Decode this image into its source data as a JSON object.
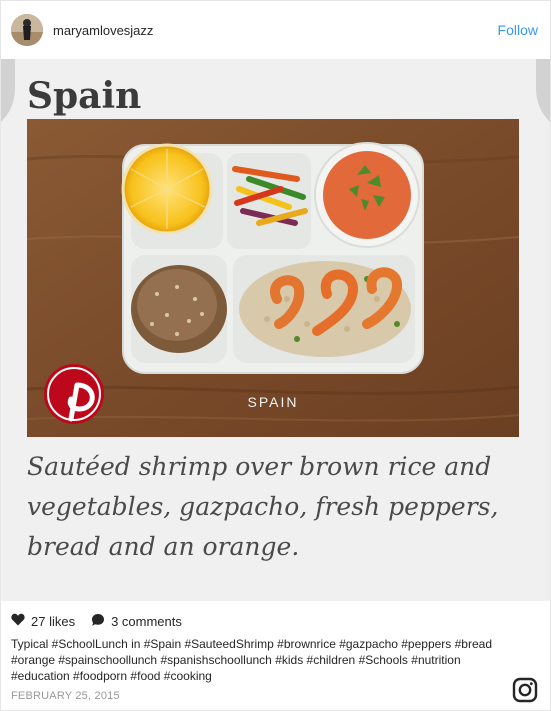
{
  "header": {
    "username": "maryamlovesjazz",
    "follow_label": "Follow"
  },
  "media": {
    "heading": "Spain",
    "photo_label": "SPAIN",
    "caption": "Sautéed shrimp over brown rice and vegetables, gazpacho, fresh peppers, bread and an orange.",
    "pinterest_icon": "pinterest-logo"
  },
  "stats": {
    "likes": "27 likes",
    "comments": "3 comments",
    "like_icon": "heart-icon",
    "comment_icon": "comment-bubble-icon"
  },
  "post": {
    "description": "Typical #SchoolLunch in #Spain #SauteedShrimp #brownrice #gazpacho #peppers #bread #orange #spainschoollunch #spanishschoollunch #kids #children #Schools #nutrition #education #foodporn #food #cooking",
    "date": "FEBRUARY 25, 2015"
  },
  "colors": {
    "link_blue": "#3897f0",
    "pinterest_red": "#bd081c"
  }
}
